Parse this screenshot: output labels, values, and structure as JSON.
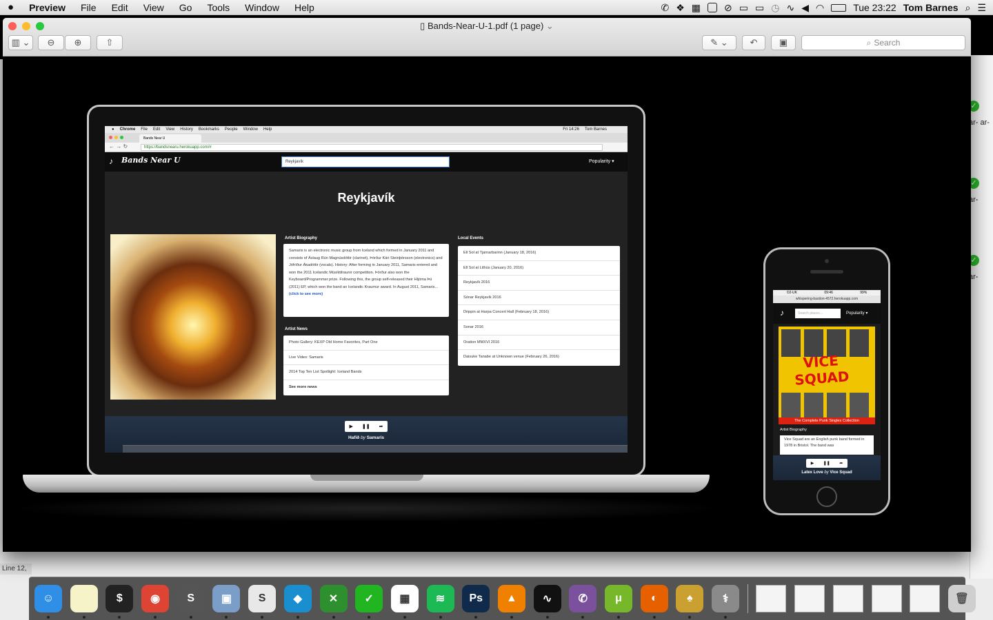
{
  "menubar": {
    "app": "Preview",
    "items": [
      "File",
      "Edit",
      "View",
      "Go",
      "Tools",
      "Window",
      "Help"
    ],
    "clock": "Tue 23:22",
    "user": "Tom Barnes",
    "icons": [
      "viber-icon",
      "dropbox-icon",
      "grid-icon",
      "clipboard-icon",
      "sync-icon",
      "display-icon",
      "airplay-icon",
      "time-machine-icon",
      "activity-icon",
      "volume-icon",
      "wifi-icon",
      "battery-icon",
      "search-icon",
      "list-icon"
    ]
  },
  "window": {
    "title": "Bands-Near-U-1.pdf (1 page)",
    "search_placeholder": "Search"
  },
  "background": {
    "line_info": "Line 12,",
    "right_text": [
      "ar- ar-",
      "ar-",
      "ar-"
    ]
  },
  "laptop": {
    "menubar": [
      "Chrome",
      "File",
      "Edit",
      "View",
      "History",
      "Bookmarks",
      "People",
      "Window",
      "Help"
    ],
    "menubar_right": "Fri 14:26",
    "menubar_user": "Tom Barnes",
    "tab_title": "Bands Near U",
    "url": "https://bandsnearu.herokuapp.com/#",
    "site": {
      "logo": "Bands Near U",
      "search_value": "Reykjavík",
      "sort": "Popularity ▾",
      "city": "Reykjavík",
      "bio_label": "Artist Biography",
      "bio": "Samaris is an electronic music group from Iceland which formed in January 2011 and consists of Áslaug Rún Magnúsdóttir (clarinet), Þórður Kári Steinþórsson (electronics) and Jófríður Ákadóttir (vocals). History: After forming in January 2011, Samaris entered and won the 2011 Icelandic Músíktilraunir competition. Þórður also won the Keyboard/Programmer prize. Following this, the group self-released their Hljóma Þú (2011) EP, which won the band an Icelandic Kraumur award. In August 2011, Samaris...",
      "bio_link": "(click to see more)",
      "news_label": "Artist News",
      "news": [
        "Photo Gallery: KEXP Old Home Favorites, Part One",
        "Live Video: Samaris",
        "2014 Top Ten List Spotlight: Iceland Bands",
        "See more news"
      ],
      "events_label": "Local Events",
      "events": [
        "Ell Sol at Tjarnarbarinn (January 18, 2016)",
        "Ell Sol at Lithús (January 20, 2016)",
        "Reykjavík 2016",
        "Sónar Reykjavík 2016",
        "Drippin at Harpa Concert Hall (February 18, 2016)",
        "Sonar 2016",
        "Oration MMXVI 2016",
        "Daisuke Tanabe at Unknown venue (February 26, 2016)"
      ],
      "player_track": "Hafið",
      "player_by": "by",
      "player_artist": "Samaris"
    }
  },
  "phone": {
    "carrier": "O2-UK",
    "time": "09:46",
    "battery": "99%",
    "url": "whispering-bastion-4572.herokuapp.com",
    "search_placeholder": "Search places...",
    "sort": "Popularity ▾",
    "album_banner": "VICE SQUAD",
    "album_caption": "The Complete Punk Singles Collection",
    "bio_label": "Artist Biography",
    "bio": "Vice Squad are an English punk band formed in 1978 in Bristol. The band was",
    "player_track": "Latex Love",
    "player_by": "by",
    "player_artist": "Vice Squad"
  },
  "dock": {
    "apps": [
      {
        "name": "Finder",
        "color": "#2f8fe6",
        "glyph": "☺"
      },
      {
        "name": "Notes",
        "color": "#f7f3c8",
        "glyph": ""
      },
      {
        "name": "Terminal",
        "color": "#222222",
        "glyph": "$"
      },
      {
        "name": "Chrome",
        "color": "#dd4433",
        "glyph": "◉"
      },
      {
        "name": "Sublime Text",
        "color": "#555555",
        "glyph": "S"
      },
      {
        "name": "Preview",
        "color": "#7a9ec7",
        "glyph": "▣"
      },
      {
        "name": "Slack",
        "color": "#e8e8e8",
        "glyph": "S"
      },
      {
        "name": "Kodi",
        "color": "#1a8fd0",
        "glyph": "◆"
      },
      {
        "name": "XMind",
        "color": "#2d8f2d",
        "glyph": "✕"
      },
      {
        "name": "Wunderlist",
        "color": "#22b522",
        "glyph": "✓"
      },
      {
        "name": "Launchpad",
        "color": "#ffffff",
        "glyph": "▦"
      },
      {
        "name": "Spotify",
        "color": "#1db954",
        "glyph": "≋"
      },
      {
        "name": "Photoshop",
        "color": "#0f2a4a",
        "glyph": "Ps"
      },
      {
        "name": "VLC",
        "color": "#f08000",
        "glyph": "▲"
      },
      {
        "name": "Activity Monitor",
        "color": "#111111",
        "glyph": "∿"
      },
      {
        "name": "Viber",
        "color": "#7b519d",
        "glyph": "✆"
      },
      {
        "name": "uTorrent",
        "color": "#76b82a",
        "glyph": "μ"
      },
      {
        "name": "Firefox",
        "color": "#e66000",
        "glyph": "◐"
      },
      {
        "name": "Cocktail",
        "color": "#caa030",
        "glyph": "♠"
      },
      {
        "name": "Disk Utility",
        "color": "#8a8a8a",
        "glyph": "⚕"
      }
    ]
  }
}
